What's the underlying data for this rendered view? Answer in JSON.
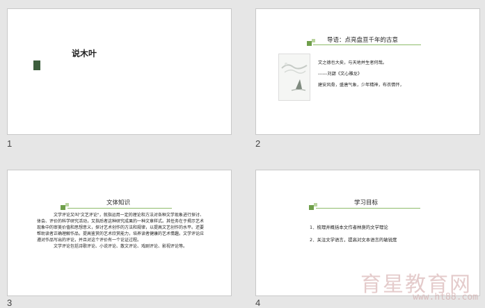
{
  "slides": [
    {
      "number": "1",
      "title": "说木叶"
    },
    {
      "number": "2",
      "title": "导语：点亮盘亘千年的古意",
      "lines": [
        "文之德也大矣，与天地并生者何哉。",
        "------刘勰《文心雕龙》",
        "建安风骨，盛唐气象，少年精神，布衣情怀，"
      ],
      "image": "ink-landscape-painting"
    },
    {
      "number": "3",
      "title": "文体知识",
      "paragraphs": [
        "文学评论又叫\"文艺评论\"，就指运用一定的理论和方法对各种文学现象进行探讨、体会、评价的科学研究活动，又指后者这种研究成果的一种文章样式。其任务在于揭示艺术现象中的审美价值和思想意义，探讨艺术创作的方法和规律，以提高文艺创作的水平。还要帮助读者正确理解作品，提高鉴赏的艺术欣赏能力，培养读者健康的艺术情趣。文学评论应遵对作品写出的评论，并且对这个评价有一个论证过程。",
        "文学评论包括诗歌评论、小说评论、散文评论、戏剧评论、影视评论等。"
      ]
    },
    {
      "number": "4",
      "title": "学习目标",
      "items": [
        "1．梳理并概括本文作者林庚的文学理论",
        "2．关注文学语言，提高对文本语言的敏锐度"
      ]
    }
  ],
  "watermark": {
    "text": "育星教育网",
    "url": "www.ht88.com"
  },
  "colors": {
    "accent_dark": "#3d5e3d",
    "accent_green": "#6f9f4b",
    "accent_light": "#b9d49e"
  }
}
